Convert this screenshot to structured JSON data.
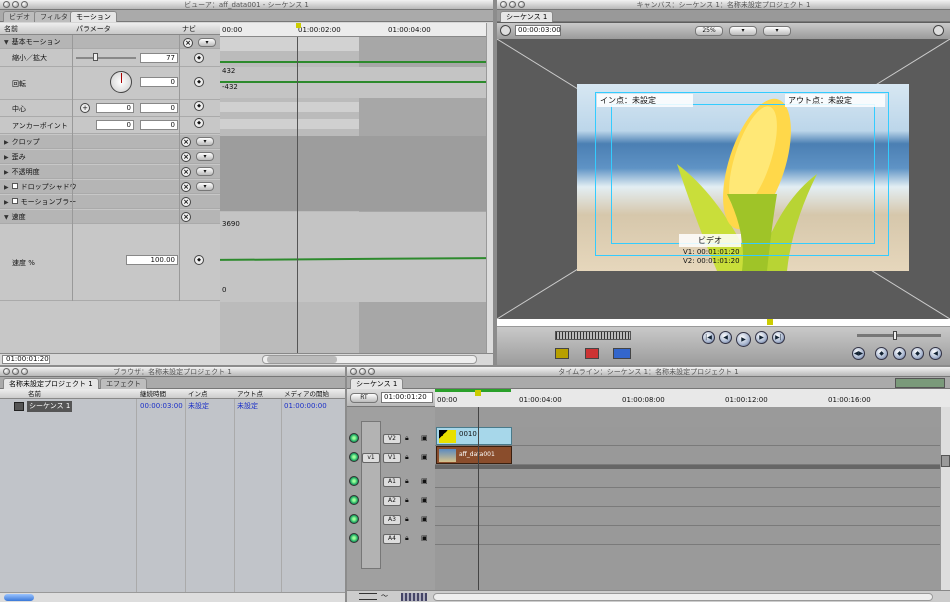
{
  "viewer": {
    "title": "ビューア：aff_data001 - シーケンス 1",
    "tabs": [
      "ビデオ",
      "フィルタ",
      "モーション"
    ],
    "cols": {
      "name": "名前",
      "param": "パラメータ",
      "nav": "ナビ"
    },
    "ruler": [
      "00:00",
      "01:00:02:00",
      "01:00:04:00"
    ],
    "groups": {
      "basic": "基本モーション",
      "scale": "縮小／拡大",
      "scale_val": "77",
      "rotate": "回転",
      "rotate_val": "0",
      "rot_top": "432",
      "rot_bot": "-432",
      "center": "中心",
      "center_x": "0",
      "center_y": "0",
      "anchor": "アンカーポイント",
      "anchor_x": "0",
      "anchor_y": "0",
      "crop": "クロップ",
      "distort": "歪み",
      "opacity": "不透明度",
      "shadow": "ドロップシャドウ",
      "blur": "モーションブラー",
      "speed": "速度",
      "speed_pct": "速度 %",
      "speed_val": "100.00",
      "spd_top": "3690",
      "spd_bot": "0"
    },
    "timecode": "01:00:01:20"
  },
  "canvas": {
    "title": "キャンバス：シーケンス 1：名称未設定プロジェクト 1",
    "tab": "シーケンス 1",
    "timecode": "00:00:03:00",
    "zoom": "25%",
    "in_label": "イン点：未設定",
    "out_label": "アウト点：未設定",
    "overlay": "ビデオ",
    "v1": "V1: 00:01:01:20",
    "v2": "V2: 00:01:01:20"
  },
  "browser": {
    "title": "ブラウザ：名称未設定プロジェクト 1",
    "tabs": [
      "名称未設定プロジェクト 1",
      "エフェクト"
    ],
    "cols": [
      "名前",
      "継続時間",
      "イン点",
      "アウト点",
      "メディアの開始"
    ],
    "row": {
      "name": "シーケンス 1",
      "duration": "00:00:03:00",
      "in": "未設定",
      "out": "未設定",
      "start": "01:00:00:00"
    }
  },
  "timeline": {
    "title": "タイムライン：シーケンス 1：名称未設定プロジェクト 1",
    "tab": "シーケンス 1",
    "rt": "RT",
    "timecode": "01:00:01:20",
    "ruler": [
      "00:00",
      "01:00:04:00",
      "01:00:08:00",
      "01:00:12:00",
      "01:00:16:00"
    ],
    "tracks": [
      "V2",
      "V1",
      "A1",
      "A2",
      "A3",
      "A4"
    ],
    "src": "v1",
    "clips": [
      {
        "name": "0010",
        "track": "V2"
      },
      {
        "name": "aff_data001",
        "track": "V1"
      }
    ]
  }
}
